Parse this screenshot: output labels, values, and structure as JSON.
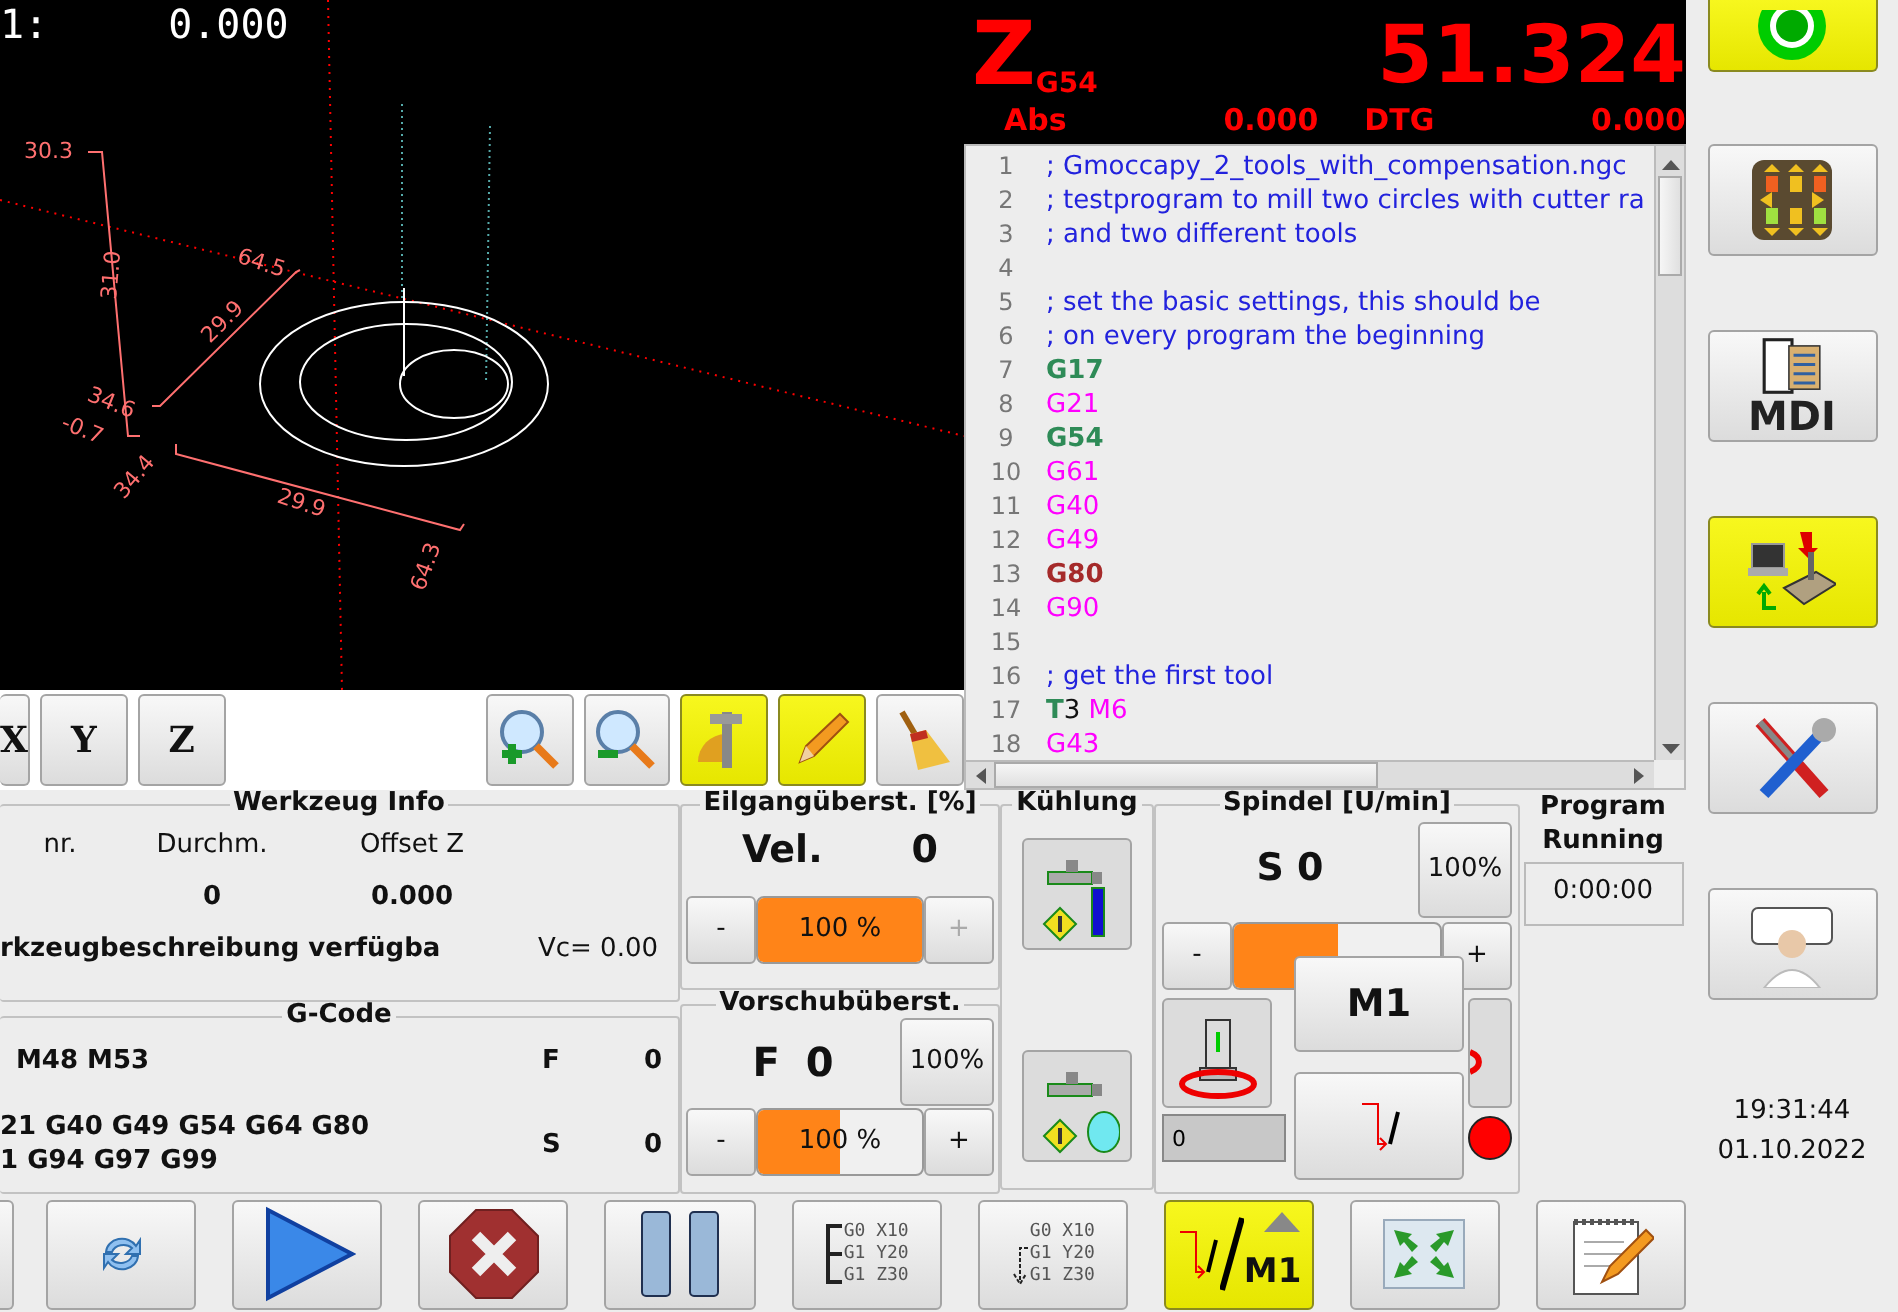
{
  "preview": {
    "readout": {
      "label": "1:",
      "value": "0.000"
    },
    "dimension_labels": [
      "30.3",
      "31.0",
      "64.5",
      "29.9",
      "34.6",
      "-0.7",
      "34.4",
      "29.9",
      "64.3"
    ],
    "tools": [
      {
        "kind": "view_x",
        "label": "X",
        "active": false
      },
      {
        "kind": "view_y",
        "label": "Y",
        "active": false
      },
      {
        "kind": "view_z",
        "label": "Z",
        "active": false
      },
      {
        "kind": "zoom_in",
        "active": false
      },
      {
        "kind": "zoom_out",
        "active": false
      },
      {
        "kind": "dimensions",
        "active": true
      },
      {
        "kind": "plot",
        "active": true
      },
      {
        "kind": "clear",
        "active": false
      }
    ]
  },
  "dro": {
    "axis": "Z",
    "system": "G54",
    "value": "51.324",
    "abs_label": "Abs",
    "abs_value": "0.000",
    "dtg_label": "DTG",
    "dtg_value": "0.000"
  },
  "gcode_listing": {
    "lines": [
      {
        "number": "1",
        "segments": [
          {
            "kind": "comment",
            "text": "; Gmoccapy_2_tools_with_compensation.ngc"
          }
        ]
      },
      {
        "number": "2",
        "segments": [
          {
            "kind": "comment",
            "text": "; testprogram to mill two circles with cutter ra"
          }
        ]
      },
      {
        "number": "3",
        "segments": [
          {
            "kind": "comment",
            "text": "; and two different tools"
          }
        ]
      },
      {
        "number": "4"
      },
      {
        "number": "5",
        "segments": [
          {
            "kind": "comment",
            "text": "; set the basic settings, this should be"
          }
        ]
      },
      {
        "number": "6",
        "segments": [
          {
            "kind": "comment",
            "text": "; on every program the beginning"
          }
        ]
      },
      {
        "number": "7",
        "segments": [
          {
            "kind": "gword",
            "text": "G17"
          }
        ]
      },
      {
        "number": "8",
        "segments": [
          {
            "kind": "modal",
            "text": "G21"
          }
        ]
      },
      {
        "number": "9",
        "segments": [
          {
            "kind": "gword",
            "text": "G54"
          }
        ]
      },
      {
        "number": "10",
        "segments": [
          {
            "kind": "modal",
            "text": "G61"
          }
        ]
      },
      {
        "number": "11",
        "segments": [
          {
            "kind": "modal",
            "text": "G40"
          }
        ]
      },
      {
        "number": "12",
        "segments": [
          {
            "kind": "modal",
            "text": "G49"
          }
        ]
      },
      {
        "number": "13",
        "segments": [
          {
            "kind": "cycle",
            "text": "G80"
          }
        ]
      },
      {
        "number": "14",
        "segments": [
          {
            "kind": "modal",
            "text": "G90"
          }
        ]
      },
      {
        "number": "15"
      },
      {
        "number": "16",
        "segments": [
          {
            "kind": "comment",
            "text": "; get the first tool"
          }
        ]
      },
      {
        "number": "17",
        "segments": [
          {
            "kind": "gword",
            "text": "T"
          },
          {
            "kind": "number",
            "text": "3 "
          },
          {
            "kind": "modal",
            "text": "M6"
          }
        ]
      },
      {
        "number": "18",
        "segments": [
          {
            "kind": "modal",
            "text": "G43"
          }
        ]
      }
    ]
  },
  "tool_info": {
    "title": "Werkzeug Info",
    "columns": [
      {
        "heading": "nr."
      },
      {
        "heading": "Durchm.",
        "value": "0"
      },
      {
        "heading": "Offset Z",
        "value": "0.000"
      }
    ],
    "description": "rkzeugbeschreibung verfügba",
    "vc": "Vc= 0.00"
  },
  "gcode_status": {
    "title": "G-Code",
    "mcodes": "M48 M53",
    "gcodes": [
      "21 G40 G49 G54 G64 G80",
      "1 G94 G97 G99"
    ],
    "f_label": "F",
    "f_value": "0",
    "s_label": "S",
    "s_value": "0"
  },
  "rapid_override": {
    "title": "Eilgangüberst. [%]",
    "label": "Vel.",
    "value": "0",
    "minus": "-",
    "plus": "+",
    "plus_disabled": true,
    "slider_text": "100 %",
    "level": 1.0
  },
  "feed_override": {
    "title": "Vorschubüberst.",
    "label": "F",
    "value": "0",
    "reset": "100%",
    "minus": "-",
    "plus": "+",
    "slider_text": "100 %",
    "level": 0.5
  },
  "coolant": {
    "title": "Kühlung",
    "buttons": [
      {
        "kind": "flood"
      },
      {
        "kind": "mist"
      }
    ]
  },
  "spindle": {
    "title": "Spindel [U/min]",
    "value": "S 0",
    "reset": "100%",
    "minus": "-",
    "plus": "+",
    "level": 0.5,
    "speed_field": "0",
    "at_speed": false
  },
  "program_timer": {
    "title": "Program Running",
    "elapsed": "0:00:00"
  },
  "popup_menu": {
    "items": [
      {
        "kind": "optional_stop",
        "label": "M1"
      },
      {
        "kind": "block_delete"
      }
    ]
  },
  "bottom_toolbar": [
    {
      "kind": "partial",
      "selected": false
    },
    {
      "kind": "reload",
      "selected": false
    },
    {
      "kind": "run",
      "selected": false
    },
    {
      "kind": "stop",
      "selected": false
    },
    {
      "kind": "pause",
      "selected": false
    },
    {
      "kind": "step",
      "lines": [
        "G0 X10",
        "G1 Y20",
        "G1 Z30"
      ],
      "selected": false
    },
    {
      "kind": "run_from_line",
      "lines": [
        "G0 X10",
        "G1 Y20",
        "G1 Z30"
      ],
      "selected": false
    },
    {
      "kind": "optional_stop",
      "label": "M1",
      "selected": true
    },
    {
      "kind": "fullscreen",
      "selected": false
    },
    {
      "kind": "edit",
      "selected": false
    }
  ],
  "sidebar": {
    "power": {
      "on": true
    },
    "buttons": [
      {
        "kind": "manual",
        "selected": false
      },
      {
        "kind": "mdi",
        "label": "MDI",
        "selected": false
      },
      {
        "kind": "auto",
        "selected": true
      },
      {
        "kind": "settings",
        "selected": false
      },
      {
        "kind": "user_tabs",
        "selected": false
      }
    ],
    "time": "19:31:44",
    "date": "01.10.2022"
  }
}
